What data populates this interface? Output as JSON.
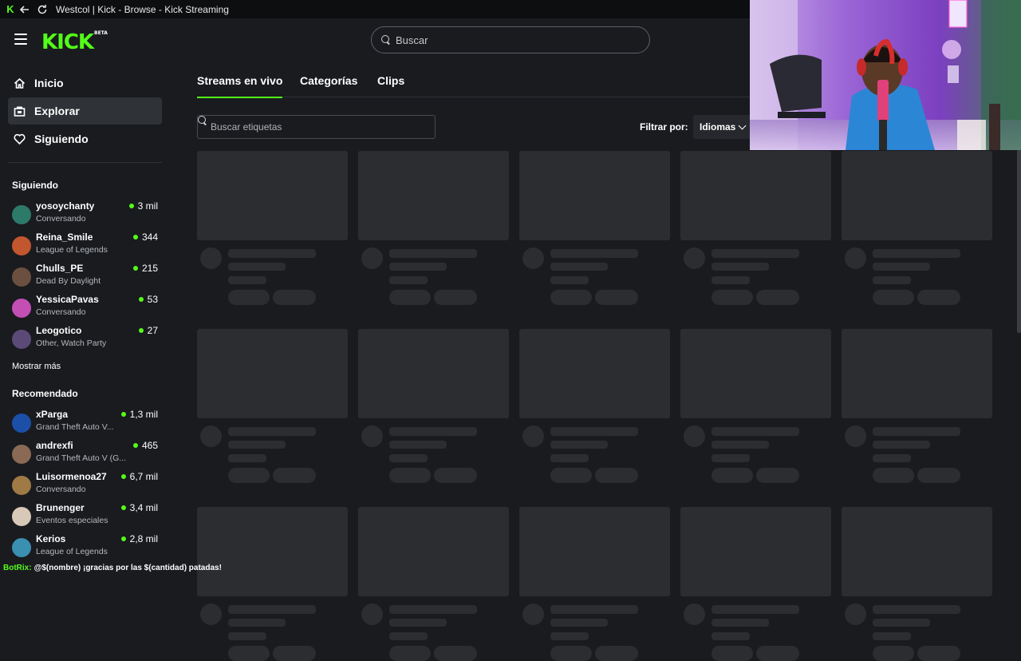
{
  "window": {
    "title": "Westcol | Kick - Browse - Kick Streaming"
  },
  "header": {
    "logo": "KICK",
    "logo_badge": "BETA",
    "search_placeholder": "Buscar"
  },
  "sidebar": {
    "nav": [
      {
        "label": "Inicio",
        "icon": "home-icon"
      },
      {
        "label": "Explorar",
        "icon": "compass-icon"
      },
      {
        "label": "Siguiendo",
        "icon": "heart-icon"
      }
    ],
    "following_title": "Siguiendo",
    "following": [
      {
        "name": "yosoychanty",
        "game": "Conversando",
        "viewers": "3 mil",
        "color": "#2e7a6a"
      },
      {
        "name": "Reina_Smile",
        "game": "League of Legends",
        "viewers": "344",
        "color": "#c2562e"
      },
      {
        "name": "Chulls_PE",
        "game": "Dead By Daylight",
        "viewers": "215",
        "color": "#6b5040"
      },
      {
        "name": "YessicaPavas",
        "game": "Conversando",
        "viewers": "53",
        "color": "#c34fb5"
      },
      {
        "name": "Leogotico",
        "game": "Other, Watch Party",
        "viewers": "27",
        "color": "#5b4a78"
      }
    ],
    "show_more": "Mostrar más",
    "recommended_title": "Recomendado",
    "recommended": [
      {
        "name": "xParga",
        "game": "Grand Theft Auto V...",
        "viewers": "1,3 mil",
        "color": "#1b4fa8"
      },
      {
        "name": "andrexfi",
        "game": "Grand Theft Auto V (G...",
        "viewers": "465",
        "color": "#8a6a55"
      },
      {
        "name": "Luisormenoa27",
        "game": "Conversando",
        "viewers": "6,7 mil",
        "color": "#a07a45"
      },
      {
        "name": "Brunenger",
        "game": "Eventos especiales",
        "viewers": "3,4 mil",
        "color": "#d8c8b8"
      },
      {
        "name": "Kerios",
        "game": "League of Legends",
        "viewers": "2,8 mil",
        "color": "#3b8fb0"
      }
    ]
  },
  "main": {
    "tabs": [
      {
        "label": "Streams en vivo",
        "active": true
      },
      {
        "label": "Categorías",
        "active": false
      },
      {
        "label": "Clips",
        "active": false
      }
    ],
    "tag_search_placeholder": "Buscar etiquetas",
    "filter_label": "Filtrar por:",
    "filter_value": "Idiomas"
  },
  "overlay": {
    "chat_name": "BotRix:",
    "chat_text": "@$(nombre) ¡gracias por las $(cantidad) patadas!"
  },
  "colors": {
    "accent": "#53fc18",
    "background": "#191b1f",
    "skeleton": "#2b2d31"
  }
}
